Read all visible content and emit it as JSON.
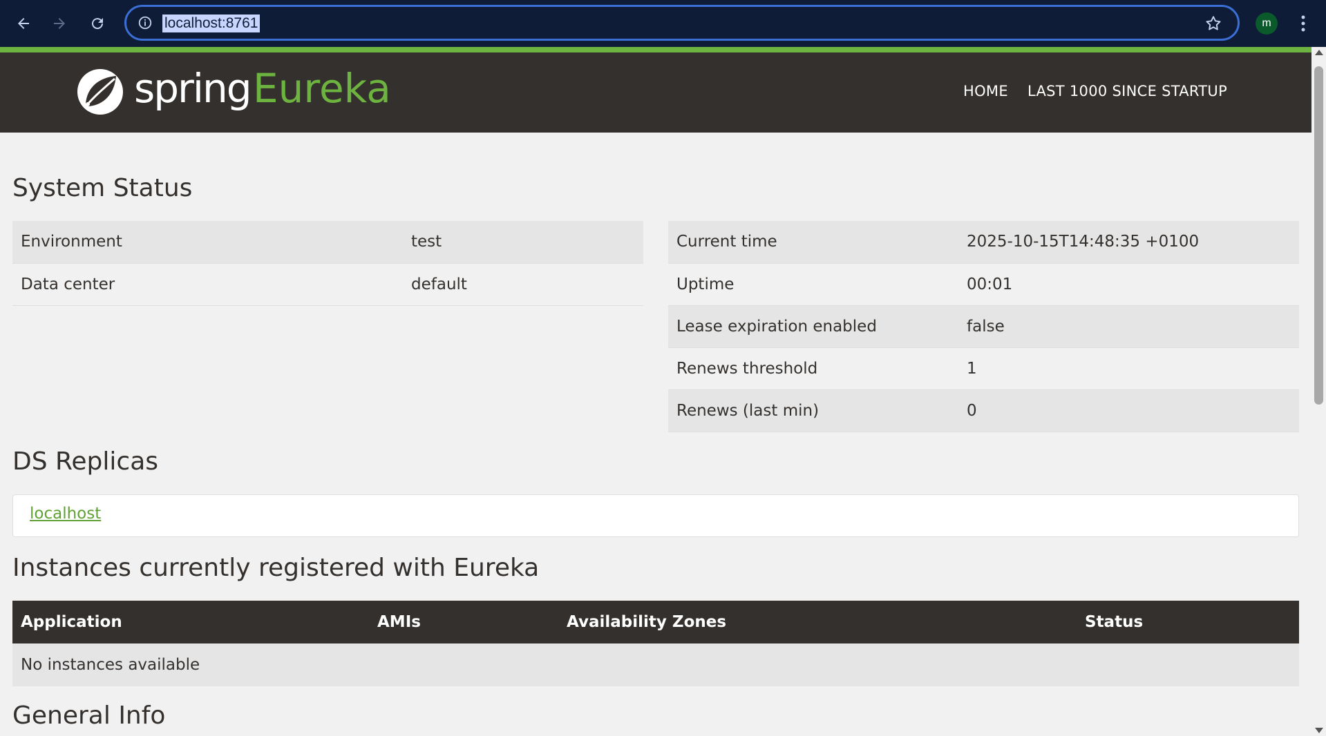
{
  "browser": {
    "url": "localhost:8761",
    "profile_initial": "m",
    "icons": {
      "back": "arrow-left-icon",
      "forward": "arrow-right-icon",
      "reload": "reload-icon",
      "info": "info-icon",
      "bookmark": "star-icon",
      "menu": "kebab-menu-icon"
    }
  },
  "header": {
    "logo_spring": "spring",
    "logo_eureka": "Eureka",
    "nav": [
      {
        "label": "HOME"
      },
      {
        "label": "LAST 1000 SINCE STARTUP"
      }
    ]
  },
  "system_status": {
    "title": "System Status",
    "left": [
      {
        "key": "Environment",
        "value": "test"
      },
      {
        "key": "Data center",
        "value": "default"
      }
    ],
    "right": [
      {
        "key": "Current time",
        "value": "2025-10-15T14:48:35 +0100"
      },
      {
        "key": "Uptime",
        "value": "00:01"
      },
      {
        "key": "Lease expiration enabled",
        "value": "false"
      },
      {
        "key": "Renews threshold",
        "value": "1"
      },
      {
        "key": "Renews (last min)",
        "value": "0"
      }
    ]
  },
  "ds_replicas": {
    "title": "DS Replicas",
    "link": "localhost"
  },
  "instances": {
    "title": "Instances currently registered with Eureka",
    "columns": [
      "Application",
      "AMIs",
      "Availability Zones",
      "Status"
    ],
    "empty_text": "No instances available"
  },
  "general_info": {
    "title": "General Info"
  },
  "colors": {
    "brand_green": "#6db33f",
    "header_dark": "#34302d",
    "chrome_bg": "#0f1c37"
  }
}
